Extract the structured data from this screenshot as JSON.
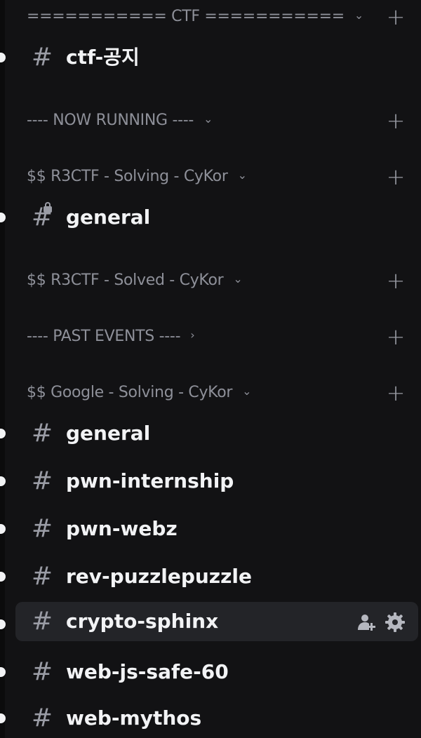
{
  "categories": [
    {
      "label": "=========== CTF ===========",
      "chevron": "⌄"
    },
    {
      "label": "---- NOW RUNNING ----",
      "chevron": "⌄"
    },
    {
      "label": "$$ R3CTF - Solving - CyKor",
      "chevron": "⌄"
    },
    {
      "label": "$$ R3CTF - Solved - CyKor",
      "chevron": "⌄"
    },
    {
      "label": "---- PAST EVENTS ----",
      "chevron": "›"
    },
    {
      "label": "$$ Google - Solving - CyKor",
      "chevron": "⌄"
    }
  ],
  "add_symbol": "+",
  "hash_symbol": "#",
  "channels": [
    {
      "name": "ctf-공지"
    },
    {
      "name": "general"
    },
    {
      "name": "general"
    },
    {
      "name": "pwn-internship"
    },
    {
      "name": "pwn-webz"
    },
    {
      "name": "rev-puzzlepuzzle"
    },
    {
      "name": "crypto-sphinx"
    },
    {
      "name": "web-js-safe-60"
    },
    {
      "name": "web-mythos"
    }
  ],
  "icons": {
    "channel": "hash-icon",
    "locked": "lock-icon",
    "add": "plus-icon",
    "invite": "add-member-icon",
    "settings": "gear-icon",
    "expanded": "chevron-down-icon",
    "collapsed": "chevron-right-icon"
  }
}
